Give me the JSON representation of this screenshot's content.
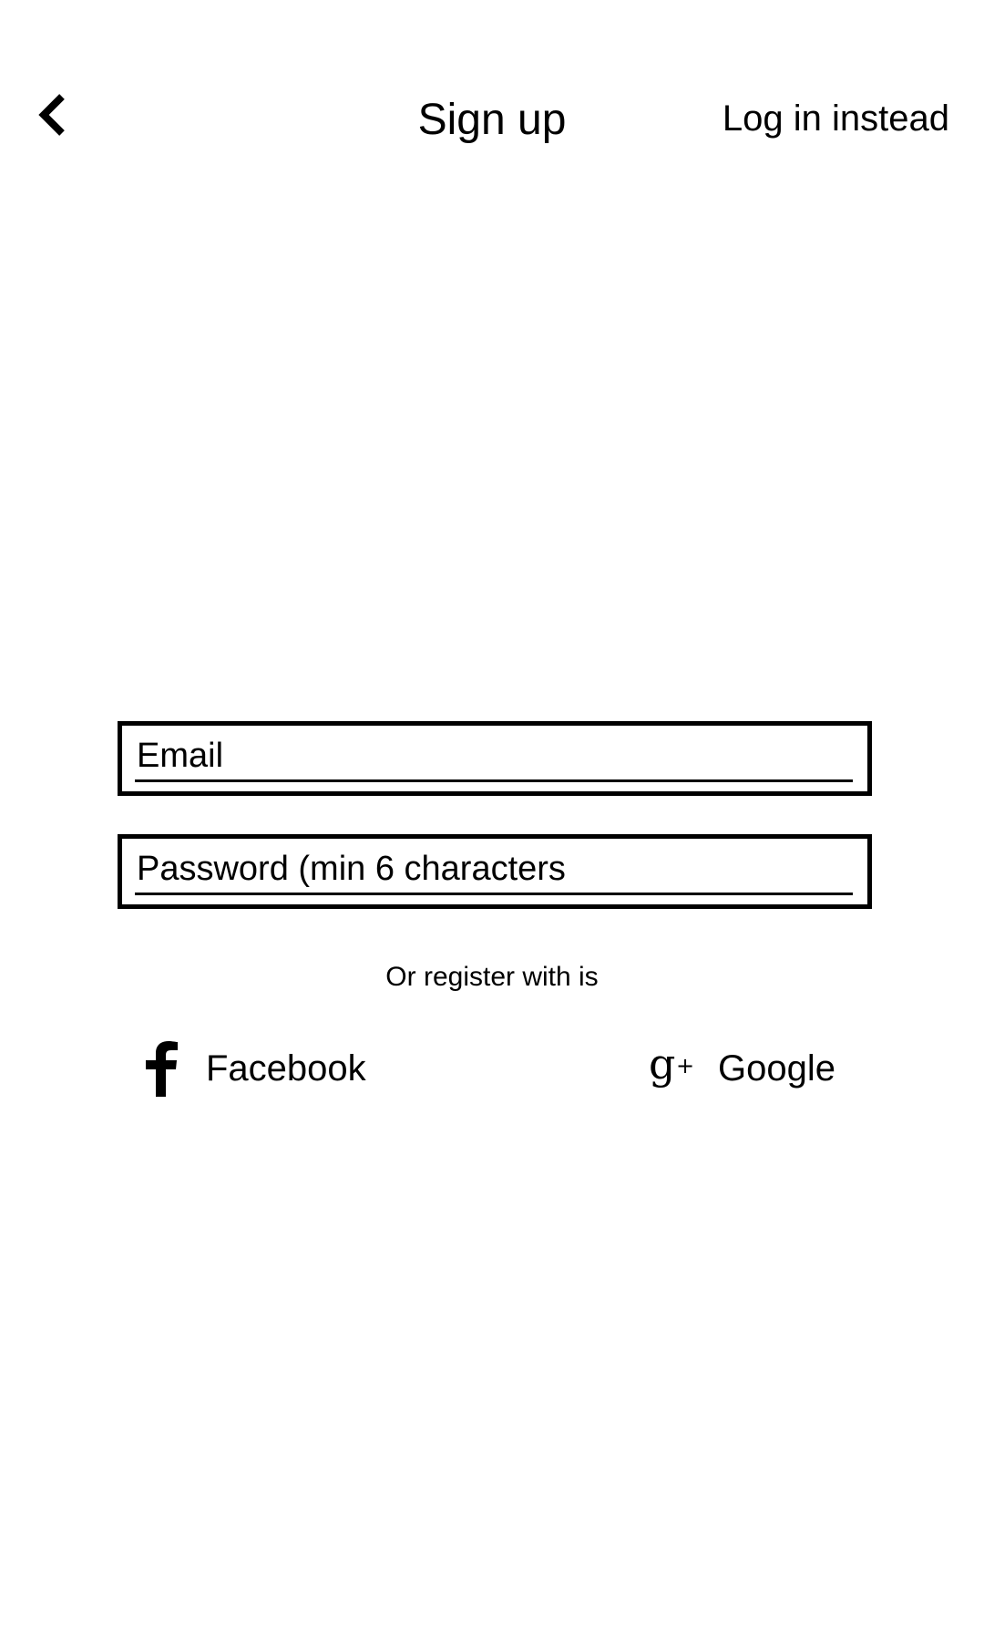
{
  "header": {
    "title": "Sign up",
    "login_link": "Log in instead"
  },
  "form": {
    "email_placeholder": "Email",
    "password_placeholder": "Password (min 6 characters"
  },
  "social": {
    "prompt": "Or register with is",
    "facebook_label": "Facebook",
    "google_label": "Google"
  }
}
